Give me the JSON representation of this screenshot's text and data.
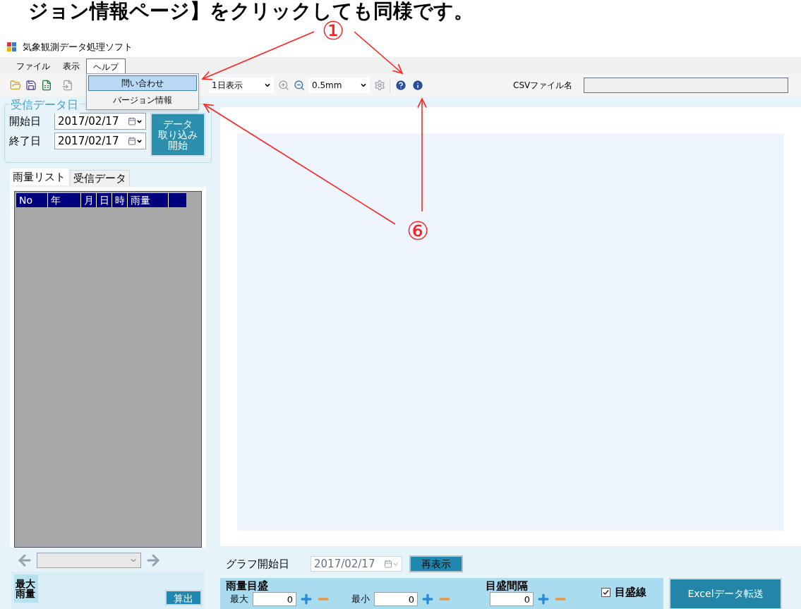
{
  "caption": "ジョン情報ページ】をクリックしても同様です。",
  "annotations": [
    {
      "label": "①"
    },
    {
      "label": "⑥"
    }
  ],
  "window": {
    "title": "気象観測データ処理ソフト"
  },
  "menu": [
    {
      "label": "ファイル",
      "selected": false
    },
    {
      "label": "表示",
      "selected": false
    },
    {
      "label": "ヘルプ",
      "selected": true
    }
  ],
  "help_menu": [
    {
      "label": "問い合わせ",
      "selected": true
    },
    {
      "label": "バージョン情報",
      "selected": false
    }
  ],
  "toolbar": {
    "view_combo": "1日表示",
    "scale_combo": "0.5mm",
    "csv_label": "CSVファイル名"
  },
  "date_group": {
    "title": "受信データ日",
    "start_label": "開始日",
    "start_value": "2017/02/17",
    "end_label": "終了日",
    "end_value": "2017/02/17",
    "import_button": [
      "データ",
      "取り込み",
      "開始"
    ]
  },
  "tabs": [
    {
      "label": "雨量リスト",
      "selected": true
    },
    {
      "label": "受信データ",
      "selected": false
    }
  ],
  "table": {
    "columns": [
      "No",
      "年",
      "月",
      "日",
      "時",
      "雨量"
    ]
  },
  "max_rain": {
    "label": "最大雨量",
    "button": "算出"
  },
  "graph": {
    "start_label": "グラフ開始日",
    "start_value": "2017/02/17",
    "start_disabled": true,
    "redraw_button": "再表示"
  },
  "scale": {
    "title": "雨量目盛",
    "max_label": "最大",
    "max_value": "0",
    "min_label": "最小",
    "min_value": "0",
    "interval_title": "目盛間隔",
    "interval_value": "0",
    "gridlines_label": "目盛線",
    "gridlines_checked": true
  },
  "excel_button": "Excelデータ転送"
}
